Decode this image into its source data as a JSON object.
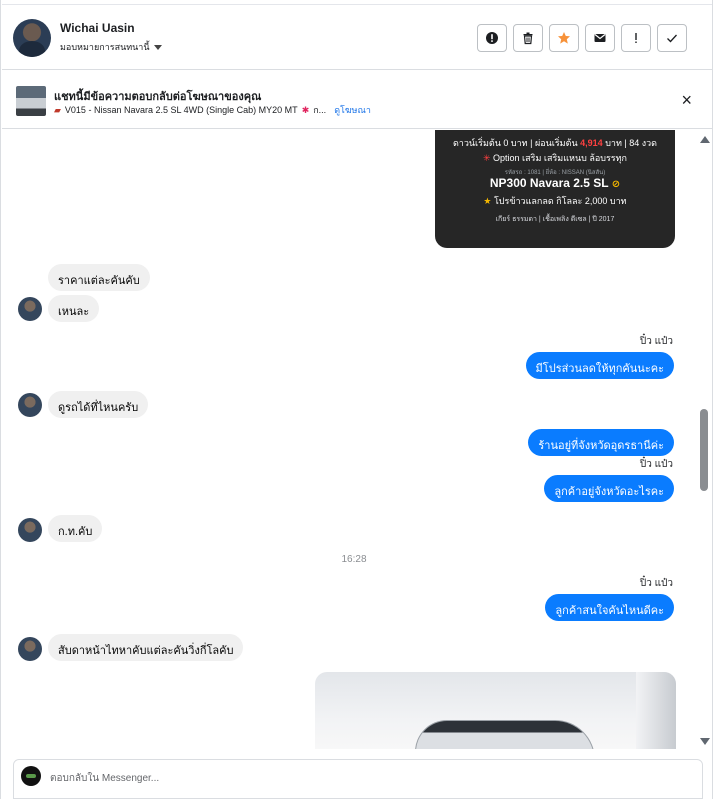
{
  "header": {
    "user_name": "Wichai Uasin",
    "assign_label": "มอบหมายการสนทนานี้",
    "actions": [
      {
        "icon": "alert-circle-icon",
        "glyph": "!"
      },
      {
        "icon": "trash-icon",
        "glyph": ""
      },
      {
        "icon": "star-icon",
        "glyph": "★"
      },
      {
        "icon": "mail-icon",
        "glyph": ""
      },
      {
        "icon": "exclamation-icon",
        "glyph": "!"
      },
      {
        "icon": "check-icon",
        "glyph": "✓"
      }
    ],
    "star_color": "#f7923a"
  },
  "ad_banner": {
    "title": "แชทนี้มีข้อความตอบกลับต่อโฆษณาของคุณ",
    "subtitle": "V015 - Nissan Navara 2.5 SL 4WD (Single Cab) MY20 MT",
    "subtitle_more": "ก...",
    "link": "ดูโฆษณา",
    "close": "×"
  },
  "ad_image": {
    "line_price": "ดาวน์เริ่มต้น 0 บาท | ผ่อนเริ่มต้น",
    "line_price_amount": "4,914",
    "line_price_tail": "บาท | 84 งวด",
    "line_option": "Option เสริม เสริมแหนบ ล้อบรรทุก",
    "line_code": "รหัสรถ : 1081 | ยี่ห้อ : NISSAN (นิสสัน)",
    "line_model": "NP300 Navara 2.5 SL",
    "line_promo": "โปรข้าวแลกลด กิโลละ 2,000 บาท",
    "line_specs": "เกียร์ ธรรมดา | เชื้อเพลิง ดีเซล | ปี 2017"
  },
  "messages": {
    "m1": "ราคาแต่ละคันคับ",
    "m2": "เหนละ",
    "seen1": "ปิ๋ว แป๋ว",
    "m3": "มีโปรส่วนลดให้ทุกคันนะคะ",
    "m4": "ดูรถได้ที่ไหนครับ",
    "m5": "ร้านอยู่ที่จังหวัดอุดรธานีค่ะ",
    "seen2": "ปิ๋ว แป๋ว",
    "m6": "ลูกค้าอยู่จังหวัดอะไรคะ",
    "m7": "ก.ท.คับ",
    "time1": "16:28",
    "seen3": "ปิ๋ว แป๋ว",
    "m8": "ลูกค้าสนใจคันไหนดีคะ",
    "m9": "สับดาหน้าไทหาคับแต่ละคันวิ่งกี่โลคับ"
  },
  "composer": {
    "placeholder": "ตอบกลับใน Messenger..."
  },
  "colors": {
    "outgoing_bubble": "#0a7cff",
    "incoming_bubble": "#f0f0f0",
    "link": "#1a73e8"
  }
}
